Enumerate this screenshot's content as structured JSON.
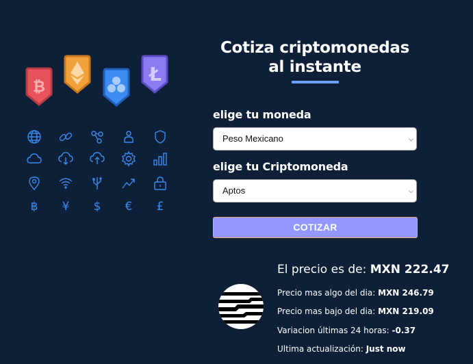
{
  "title": "Cotiza criptomonedas al instante",
  "currency": {
    "label": "elige tu moneda",
    "selected": "Peso Mexicano"
  },
  "crypto": {
    "label": "elige tu Criptomoneda",
    "selected": "Aptos"
  },
  "submit_label": "COTIZAR",
  "result": {
    "price_label": "El precio es de:",
    "price_value": "MXN 222.47",
    "high_label": "Precio mas algo del dia:",
    "high_value": "MXN 246.79",
    "low_label": "Precio mas bajo del dia:",
    "low_value": "MXN 219.09",
    "change_label": "Variacion últimas 24 horas:",
    "change_value": "-0.37",
    "updated_label": "Ultima actualización:",
    "updated_value": "Just now"
  },
  "illustration": {
    "badges": [
      "bitcoin-badge",
      "ethereum-badge",
      "ripple-badge",
      "litecoin-badge"
    ],
    "badge_colors": [
      "#e8535b",
      "#f2a23a",
      "#3d8bf0",
      "#8a7cf0"
    ],
    "icons": [
      "globe-icon",
      "link-icon",
      "molecule-icon",
      "person-icon",
      "shield-icon",
      "cloud-icon",
      "cloud-download-icon",
      "cloud-upload-icon",
      "gear-icon",
      "bar-chart-icon",
      "location-pin-icon",
      "wifi-icon",
      "usb-icon",
      "trend-up-icon",
      "lock-icon",
      "bitcoin-symbol-icon",
      "yen-icon",
      "dollar-icon",
      "euro-icon",
      "pound-icon"
    ],
    "symbols": [
      "฿",
      "¥",
      "$",
      "€",
      "£"
    ],
    "icon_color": "#3d8bf0"
  },
  "colors": {
    "background": "#0d2038",
    "accent_underline": "#66a2fe",
    "button": "#9497ff"
  }
}
